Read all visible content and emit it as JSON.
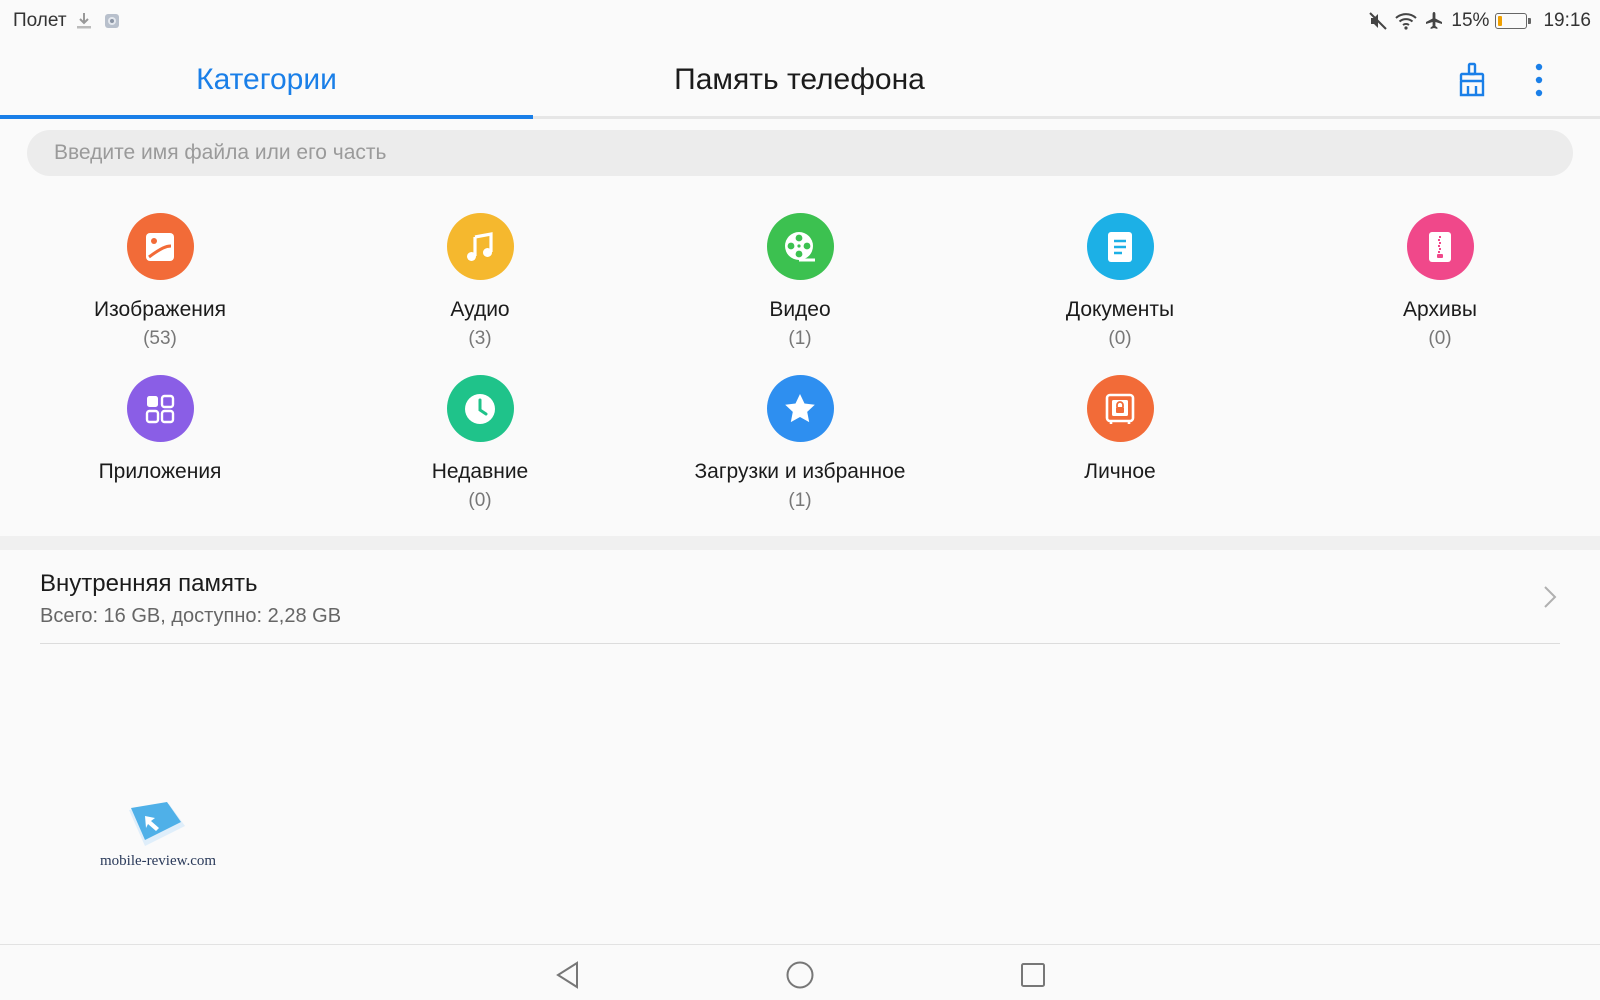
{
  "status_bar": {
    "left_text": "Полет",
    "battery_percent": "15%",
    "battery_level": 0.15,
    "time": "19:16"
  },
  "tabs": {
    "categories": "Категории",
    "storage": "Память телефона"
  },
  "search": {
    "placeholder": "Введите имя файла или его часть"
  },
  "categories": [
    {
      "label": "Изображения",
      "count": "(53)",
      "color": "#f26b38",
      "icon": "image-icon"
    },
    {
      "label": "Аудио",
      "count": "(3)",
      "color": "#f5b82e",
      "icon": "music-note-icon"
    },
    {
      "label": "Видео",
      "count": "(1)",
      "color": "#3cc150",
      "icon": "film-reel-icon"
    },
    {
      "label": "Документы",
      "count": "(0)",
      "color": "#1cb0e6",
      "icon": "document-icon"
    },
    {
      "label": "Архивы",
      "count": "(0)",
      "color": "#f0488a",
      "icon": "archive-icon"
    },
    {
      "label": "Приложения",
      "count": "",
      "color": "#8a5ee6",
      "icon": "apps-grid-icon"
    },
    {
      "label": "Недавние",
      "count": "(0)",
      "color": "#1fc38a",
      "icon": "clock-icon"
    },
    {
      "label": "Загрузки и избранное",
      "count": "(1)",
      "color": "#2e8ff0",
      "icon": "star-icon"
    },
    {
      "label": "Личное",
      "count": "",
      "color": "#f26b38",
      "icon": "safe-lock-icon"
    }
  ],
  "storage": {
    "title": "Внутренняя память",
    "subtitle": "Всего: 16 GB, доступно: 2,28 GB"
  },
  "watermark": {
    "text": "mobile-review.com"
  },
  "colors": {
    "accent": "#1a7fe8"
  }
}
